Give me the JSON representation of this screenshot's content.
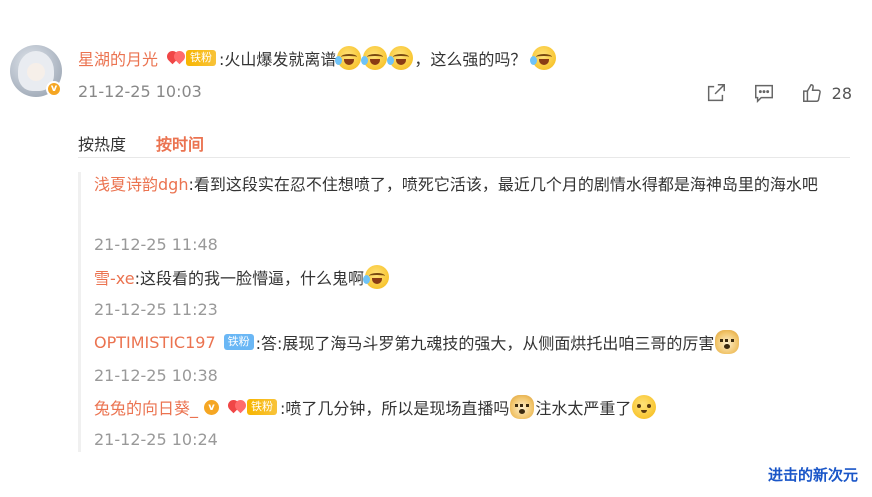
{
  "main_comment": {
    "username": "星湖的月光",
    "fan_tag": "铁粉",
    "text": ":火山爆发就离谱",
    "text_tail": "，这么强的吗？",
    "timestamp": "21-12-25 10:03",
    "like_count": "28"
  },
  "sort_tabs": [
    {
      "label": "按热度"
    },
    {
      "label": "按时间"
    }
  ],
  "replies": [
    {
      "username": "浅夏诗韵dgh",
      "text": ":看到这段实在忍不住想喷了，喷死它活该，最近几个月的剧情水得都是海神岛里的海水吧",
      "timestamp": "21-12-25 11:48"
    },
    {
      "username": "雪-xe",
      "text": ":这段看的我一脸懵逼，什么鬼啊",
      "timestamp": "21-12-25 11:23"
    },
    {
      "username": "OPTIMISTIC197",
      "fan_tag": "铁粉",
      "text": ":答:展现了海马斗罗第九魂技的强大，从侧面烘托出咱三哥的厉害",
      "timestamp": "21-12-25 10:38"
    },
    {
      "username": "兔兔的向日葵_",
      "fan_tag": "铁粉",
      "text": ":喷了几分钟，所以是现场直播吗",
      "text_tail": "注水太严重了",
      "timestamp": "21-12-25 10:24"
    }
  ],
  "watermark": "进击的新次元",
  "colors": {
    "accent": "#eb7350",
    "badge": "#f5a623",
    "watermark": "#1a56c8"
  }
}
